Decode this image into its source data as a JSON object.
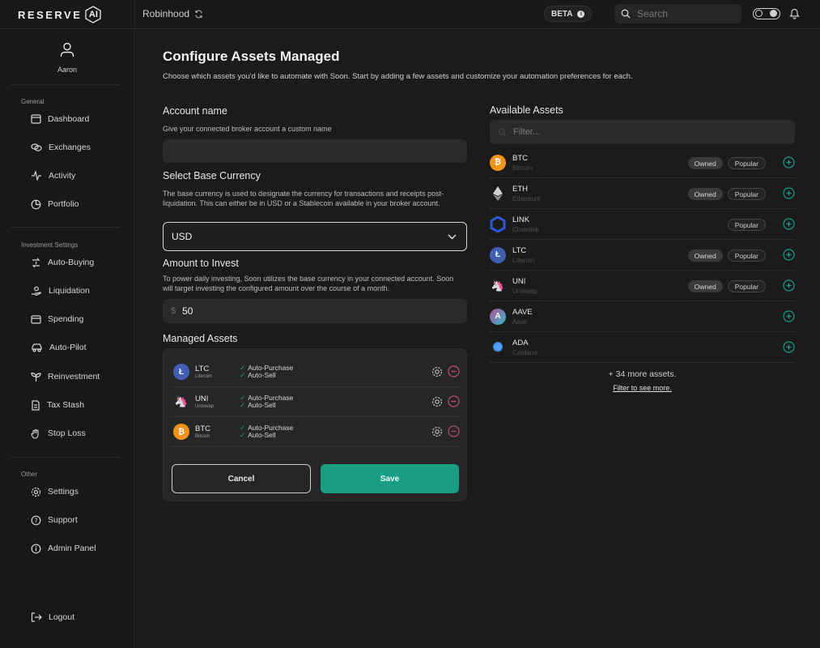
{
  "topbar": {
    "logo_text": "RESERVE",
    "logo_mark": "AI",
    "broker": "Robinhood",
    "beta_label": "BETA",
    "search_placeholder": "Search"
  },
  "sidebar": {
    "user_name": "Aaron",
    "groups": {
      "general": "General",
      "investment": "Investment Settings",
      "other": "Other"
    },
    "items": {
      "dashboard": "Dashboard",
      "exchanges": "Exchanges",
      "activity": "Activity",
      "portfolio": "Portfolio",
      "auto_buying": "Auto-Buying",
      "liquidation": "Liquidation",
      "spending": "Spending",
      "auto_pilot": "Auto-Pilot",
      "reinvestment": "Reinvestment",
      "tax_stash": "Tax Stash",
      "stop_loss": "Stop Loss",
      "settings": "Settings",
      "support": "Support",
      "admin_panel": "Admin Panel",
      "logout": "Logout"
    }
  },
  "page": {
    "title": "Configure Assets Managed",
    "subtitle": "Choose which assets you'd like to automate with Soon. Start by adding a few assets and customize your automation preferences for each."
  },
  "form": {
    "account_name": {
      "label": "Account name",
      "help": "Give your connected broker account a custom name",
      "value": ""
    },
    "base_currency": {
      "label": "Select Base Currency",
      "help": "The base currency is used to designate the currency for transactions and receipts post-liquidation. This can either be in USD or a Stablecoin available in your broker account.",
      "value": "USD"
    },
    "amount": {
      "label": "Amount to Invest",
      "help": "To power daily investing, Soon utilizes the base currency in your connected account. Soon will target investing the configured amount over the course of a month.",
      "currency_symbol": "$",
      "value": "50"
    }
  },
  "managed": {
    "label": "Managed Assets",
    "assets": [
      {
        "symbol": "LTC",
        "name": "Litecoin",
        "glyph": "Ł",
        "color": "#3f5fb3",
        "check1": "Auto-Purchase",
        "check2": "Auto-Sell"
      },
      {
        "symbol": "UNI",
        "name": "Uniswap",
        "glyph": "🦄",
        "color": "#ff007a",
        "check1": "Auto-Purchase",
        "check2": "Auto-Sell"
      },
      {
        "symbol": "BTC",
        "name": "Bitcoin",
        "glyph": "₿",
        "color": "#f2931a",
        "check1": "Auto-Purchase",
        "check2": "Auto-Sell"
      }
    ],
    "cancel_label": "Cancel",
    "save_label": "Save"
  },
  "available": {
    "label": "Available Assets",
    "filter_placeholder": "Filter...",
    "assets": [
      {
        "symbol": "BTC",
        "name": "Bitcoin",
        "glyph": "₿",
        "color": "#f2931a",
        "owned": "Owned",
        "popular": "Popular"
      },
      {
        "symbol": "ETH",
        "name": "Ethereum",
        "glyph": "◆",
        "color": "#2b2b2b",
        "owned": "Owned",
        "popular": "Popular"
      },
      {
        "symbol": "LINK",
        "name": "Chainlink",
        "glyph": "⬡",
        "color": "#2a5ada",
        "owned": "",
        "popular": "Popular"
      },
      {
        "symbol": "LTC",
        "name": "Litecoin",
        "glyph": "Ł",
        "color": "#3f5fb3",
        "owned": "Owned",
        "popular": "Popular"
      },
      {
        "symbol": "UNI",
        "name": "Uniswap",
        "glyph": "🦄",
        "color": "#ff007a",
        "owned": "Owned",
        "popular": "Popular"
      },
      {
        "symbol": "AAVE",
        "name": "Aave",
        "glyph": "A",
        "color": "#8a64c8",
        "owned": "",
        "popular": ""
      },
      {
        "symbol": "ADA",
        "name": "Cardano",
        "glyph": "✺",
        "color": "#1a3a6a",
        "owned": "",
        "popular": ""
      }
    ],
    "more_text": "+ 34 more assets.",
    "more_link": "Filter to see more."
  },
  "colors": {
    "accent": "#199e83",
    "remove": "#c04a7a",
    "background": "#1b1b1b"
  }
}
